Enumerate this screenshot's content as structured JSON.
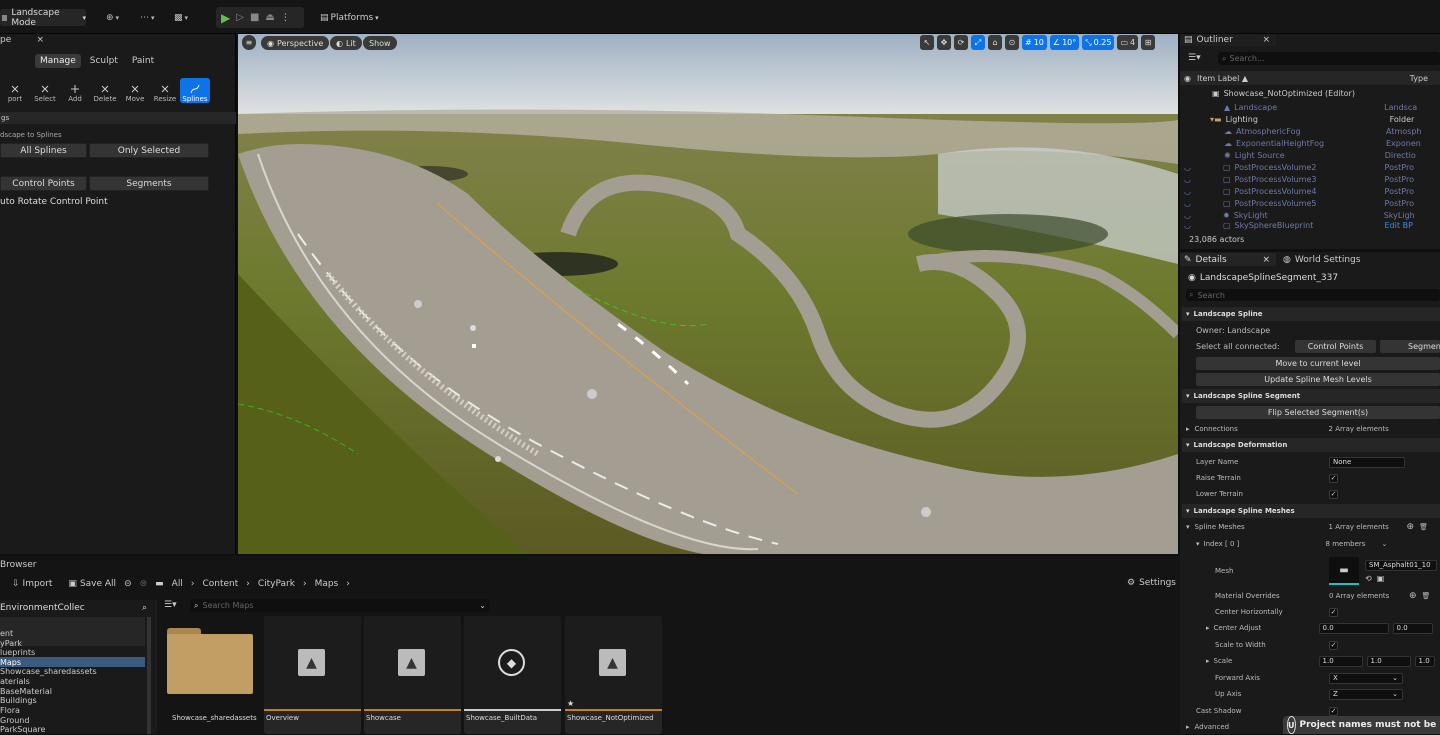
{
  "toolbar": {
    "mode_label": "Landscape Mode",
    "platforms_label": "Platforms"
  },
  "left_panel": {
    "tab_title": "pe",
    "mode_tabs": [
      "Manage",
      "Sculpt",
      "Paint"
    ],
    "tools": [
      "port",
      "Select",
      "Add",
      "Delete",
      "Move",
      "Resize",
      "Splines"
    ],
    "section_1": "gs",
    "caption": "dscape to Splines",
    "btn_all_splines": "All Splines",
    "btn_only_selected": "Only Selected",
    "btn_control_points": "Control Points",
    "btn_segments": "Segments",
    "auto_rotate": "uto Rotate Control Point"
  },
  "viewport": {
    "perspective": "Perspective",
    "lit": "Lit",
    "show": "Show",
    "grid_snap": "10",
    "angle_snap": "10°",
    "scale_snap": "0.25",
    "camera_speed": "4"
  },
  "outliner": {
    "tab": "Outliner",
    "search_placeholder": "Search...",
    "col_label": "Item Label ▲",
    "col_type": "Type",
    "rows": [
      {
        "label": "Showcase_NotOptimized (Editor)",
        "type": ""
      },
      {
        "label": "Landscape",
        "type": "Landsca"
      },
      {
        "label": "Lighting",
        "type": "Folder"
      },
      {
        "label": "AtmosphericFog",
        "type": "Atmosph"
      },
      {
        "label": "ExponentialHeightFog",
        "type": "Exponen"
      },
      {
        "label": "Light Source",
        "type": "Directio"
      },
      {
        "label": "PostProcessVolume2",
        "type": "PostPro"
      },
      {
        "label": "PostProcessVolume3",
        "type": "PostPro"
      },
      {
        "label": "PostProcessVolume4",
        "type": "PostPro"
      },
      {
        "label": "PostProcessVolume5",
        "type": "PostPro"
      },
      {
        "label": "SkyLight",
        "type": "SkyLigh"
      },
      {
        "label": "SkySphereBlueprint",
        "type": "Edit BP"
      }
    ],
    "count": "23,086 actors"
  },
  "details": {
    "tab_details": "Details",
    "tab_world": "World Settings",
    "object_name": "LandscapeSplineSegment_337",
    "search_placeholder": "Search",
    "sec_spline": "Landscape Spline",
    "owner": "Owner: Landscape",
    "select_all": "Select all connected:",
    "btn_control_points": "Control Points",
    "btn_segments": "Segmen",
    "btn_move_level": "Move to current level",
    "btn_update_mesh": "Update Spline Mesh Levels",
    "sec_segment": "Landscape Spline Segment",
    "btn_flip": "Flip Selected Segment(s)",
    "connections": "Connections",
    "connections_val": "2 Array elements",
    "sec_deform": "Landscape Deformation",
    "layer_name": "Layer Name",
    "layer_val": "None",
    "raise": "Raise Terrain",
    "lower": "Lower Terrain",
    "sec_meshes": "Landscape Spline Meshes",
    "spline_meshes": "Spline Meshes",
    "spline_meshes_val": "1 Array elements",
    "index": "Index [ 0 ]",
    "index_val": "8 members",
    "mesh": "Mesh",
    "mesh_val": "SM_Asphalt01_10",
    "mat_over": "Material Overrides",
    "mat_over_val": "0 Array elements",
    "center_h": "Center Horizontally",
    "center_adj": "Center Adjust",
    "center_adj_x": "0.0",
    "center_adj_y": "0.0",
    "scale_width": "Scale to Width",
    "scale": "Scale",
    "scale_x": "1.0",
    "scale_y": "1.0",
    "scale_z": "1.0",
    "fwd_axis": "Forward Axis",
    "fwd_val": "X",
    "up_axis": "Up Axis",
    "up_val": "Z",
    "cast_shadow": "Cast Shadow",
    "advanced": "Advanced",
    "toast": "Project names must not be lo"
  },
  "content_browser": {
    "tab": "Browser",
    "import": "Import",
    "save_all": "Save All",
    "crumbs": [
      "All",
      "Content",
      "CityPark",
      "Maps"
    ],
    "settings": "Settings",
    "collection": "EnvironmentCollec",
    "search_placeholder": "Search Maps",
    "tree": [
      "ent",
      "yPark",
      "lueprints",
      "Maps",
      "Showcase_sharedassets",
      "aterials",
      "BaseMaterial",
      "Buildings",
      "Flora",
      "Ground",
      "ParkSquare"
    ],
    "assets": [
      "Showcase_sharedassets",
      "Overview",
      "Showcase",
      "Showcase_BuiltData",
      "Showcase_NotOptimized"
    ]
  }
}
